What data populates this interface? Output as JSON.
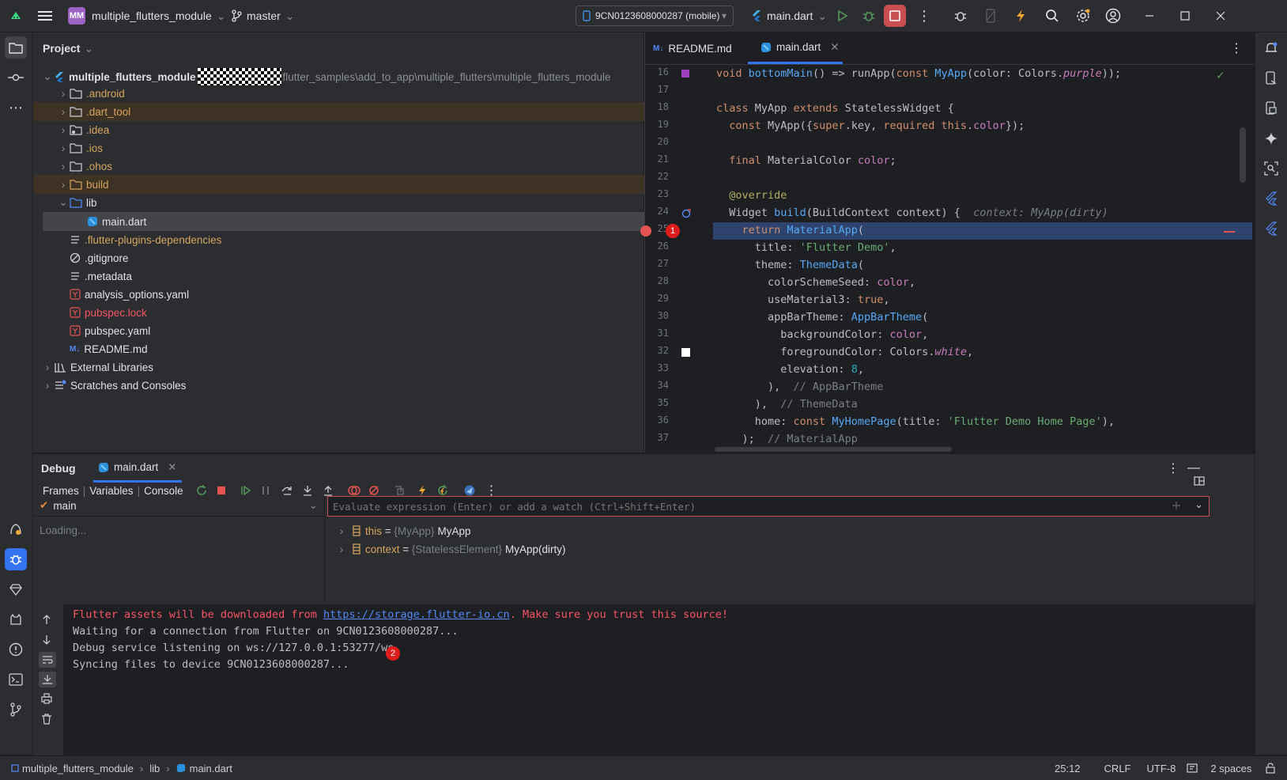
{
  "titlebar": {
    "project_badge": "MM",
    "project_name": "multiple_flutters_module",
    "branch": "master",
    "device": "9CN0123608000287 (mobile)",
    "run_config": "main.dart"
  },
  "project_panel": {
    "title": "Project",
    "root_name": "multiple_flutters_module",
    "root_path": "flutter_samples\\add_to_app\\multiple_flutters\\multiple_flutters_module",
    "items": [
      {
        "label": ".android"
      },
      {
        "label": ".dart_tool"
      },
      {
        "label": ".idea"
      },
      {
        "label": ".ios"
      },
      {
        "label": ".ohos"
      },
      {
        "label": "build"
      },
      {
        "label": "lib"
      },
      {
        "label": "main.dart"
      },
      {
        "label": ".flutter-plugins-dependencies"
      },
      {
        "label": ".gitignore"
      },
      {
        "label": ".metadata"
      },
      {
        "label": "analysis_options.yaml"
      },
      {
        "label": "pubspec.lock"
      },
      {
        "label": "pubspec.yaml"
      },
      {
        "label": "README.md"
      },
      {
        "label": "External Libraries"
      },
      {
        "label": "Scratches and Consoles"
      }
    ]
  },
  "editor": {
    "tabs": [
      {
        "label": "README.md"
      },
      {
        "label": "main.dart"
      }
    ],
    "line_numbers": [
      "16",
      "17",
      "18",
      "19",
      "20",
      "21",
      "22",
      "23",
      "24",
      "25",
      "26",
      "27",
      "28",
      "29",
      "30",
      "31",
      "32",
      "33",
      "34",
      "35",
      "36",
      "37"
    ],
    "inline_hint": "context: MyApp(dirty)",
    "marker_1": "1"
  },
  "debug": {
    "title": "Debug",
    "tab": "main.dart",
    "subtabs": [
      "Frames",
      "Variables",
      "Console"
    ],
    "thread": "main",
    "frames_status": "Loading...",
    "eval_placeholder": "Evaluate expression (Enter) or add a watch (Ctrl+Shift+Enter)",
    "variables": [
      {
        "name": "this",
        "eq": " = ",
        "type": "{MyApp}",
        "value": "MyApp"
      },
      {
        "name": "context",
        "eq": " = ",
        "type": "{StatelessElement}",
        "value": "MyApp(dirty)"
      }
    ],
    "console": {
      "warn_prefix": "Flutter assets will be downloaded from ",
      "warn_link": "https://storage.flutter-io.cn",
      "warn_suffix": ". Make sure you trust this source!",
      "lines": [
        "Waiting for a connection from Flutter on 9CN0123608000287...",
        "Debug service listening on ws://127.0.0.1:53277/ws",
        "Syncing files to device 9CN0123608000287..."
      ],
      "marker_2": "2"
    }
  },
  "statusbar": {
    "crumbs": [
      "multiple_flutters_module",
      "lib",
      "main.dart"
    ],
    "position": "25:12",
    "line_sep": "CRLF",
    "encoding": "UTF-8",
    "indent": "2 spaces"
  },
  "colors": {
    "accent": "#3574f0",
    "exec_line": "#2e436e",
    "breakpoint": "#e55353",
    "warning_text": "#f75464",
    "ignored_folder": "#d5a65e"
  }
}
